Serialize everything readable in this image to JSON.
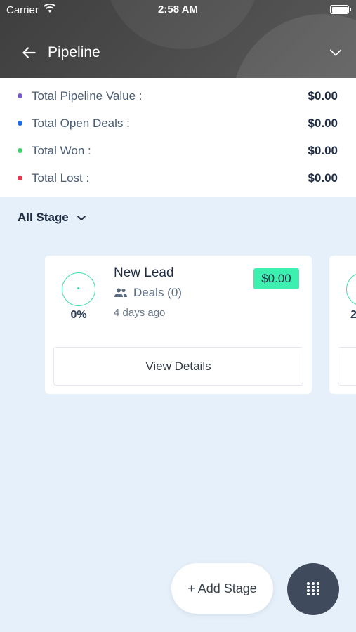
{
  "status_bar": {
    "carrier": "Carrier",
    "time": "2:58 AM"
  },
  "nav": {
    "title": "Pipeline"
  },
  "summary": [
    {
      "label": "Total Pipeline Value :",
      "value": "$0.00",
      "color": "#7b5cc8"
    },
    {
      "label": "Total Open Deals :",
      "value": "$0.00",
      "color": "#1e6de8"
    },
    {
      "label": "Total Won :",
      "value": "$0.00",
      "color": "#3fcf6b"
    },
    {
      "label": "Total Lost :",
      "value": "$0.00",
      "color": "#e63950"
    }
  ],
  "filter": {
    "label": "All Stage"
  },
  "stages": [
    {
      "name": "New Lead",
      "percent": "0%",
      "deals": "Deals (0)",
      "updated": "4 days ago",
      "amount": "$0.00",
      "button": "View Details"
    },
    {
      "percent": "2"
    }
  ],
  "actions": {
    "add_stage": "+ Add Stage"
  },
  "colors": {
    "accent": "#3ef0b0",
    "header": "#4a4a4a",
    "fab": "#3f4a5d",
    "background": "#e6f0fa"
  }
}
